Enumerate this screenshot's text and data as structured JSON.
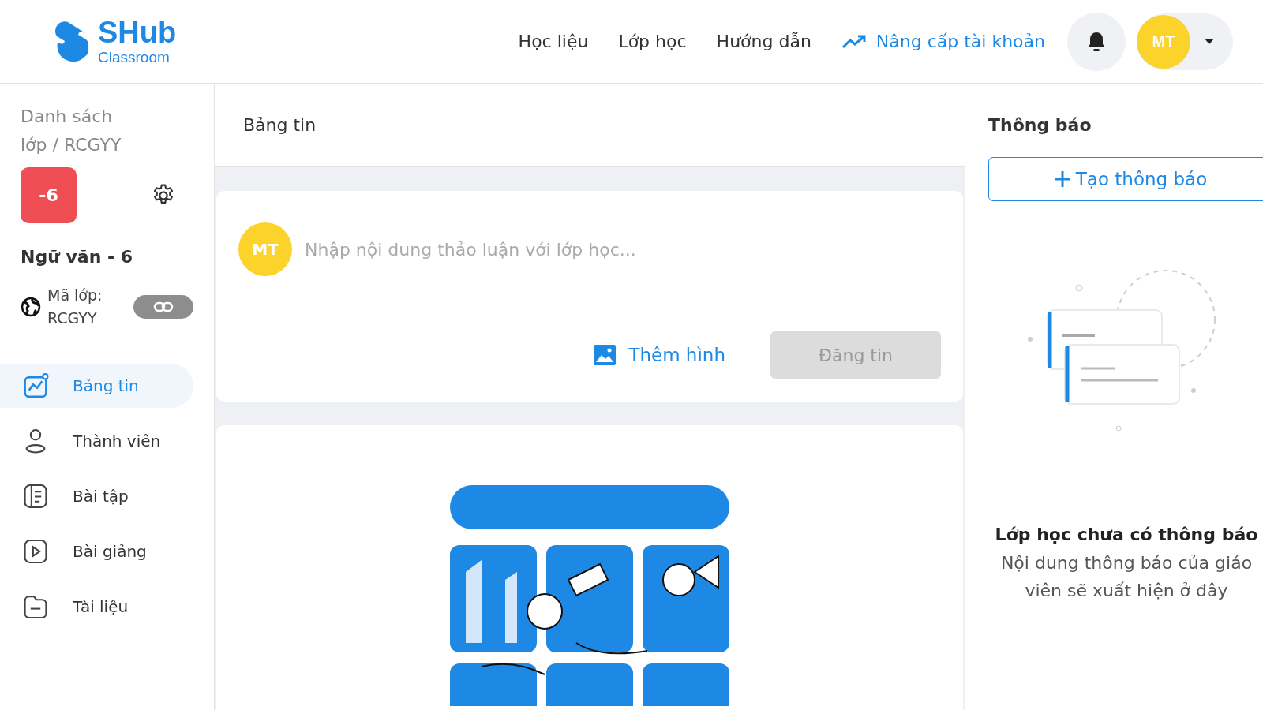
{
  "header": {
    "logo": {
      "name": "SHub",
      "subtitle": "Classroom"
    },
    "nav": [
      {
        "label": "Học liệu",
        "kind": "plain"
      },
      {
        "label": "Lớp học",
        "kind": "plain"
      },
      {
        "label": "Hướng dẫn",
        "kind": "plain"
      },
      {
        "label": "Nâng cấp tài khoản",
        "kind": "upgrade"
      }
    ],
    "user": {
      "initials": "MT"
    }
  },
  "sidebar": {
    "breadcrumb": "Danh sách lớp / RCGYY",
    "class_badge": "-6",
    "class_name": "Ngữ văn - 6",
    "class_code_label": "Mã lớp:",
    "class_code": "RCGYY",
    "items": [
      {
        "label": "Bảng tin",
        "kind": "chart",
        "selected": true
      },
      {
        "label": "Thành viên",
        "kind": "person",
        "selected": false
      },
      {
        "label": "Bài tập",
        "kind": "list",
        "selected": false
      },
      {
        "label": "Bài giảng",
        "kind": "play",
        "selected": false
      },
      {
        "label": "Tài liệu",
        "kind": "folder",
        "selected": false
      }
    ]
  },
  "feed": {
    "title": "Bảng tin",
    "composer": {
      "initials": "MT",
      "placeholder": "Nhập nội dung thảo luận với lớp học...",
      "add_image": "Thêm hình",
      "post_button": {
        "label": "Đăng tin",
        "disabled": true
      }
    }
  },
  "notifications": {
    "title": "Thông báo",
    "create_button": "Tạo thông báo",
    "empty_title": "Lớp học chưa có thông báo",
    "empty_text": "Nội dung thông báo của giáo viên sẽ xuất hiện ở đây"
  }
}
